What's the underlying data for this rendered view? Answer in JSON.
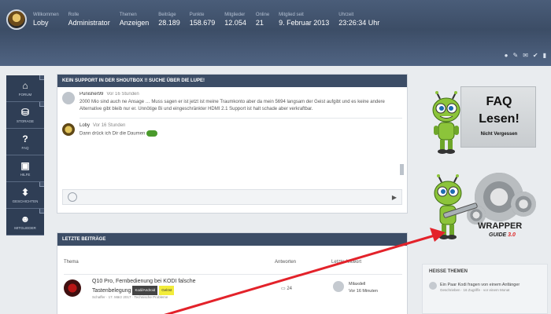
{
  "header": {
    "stats": [
      {
        "key": "Willkommen",
        "value": "Loby"
      },
      {
        "key": "Rolle",
        "value": "Administrator"
      },
      {
        "key": "Themen",
        "value": "Anzeigen"
      },
      {
        "key": "Beiträge",
        "value": "28.189"
      },
      {
        "key": "Punkte",
        "value": "158.679"
      },
      {
        "key": "Mitglieder",
        "value": "12.054"
      },
      {
        "key": "Online",
        "value": "21"
      },
      {
        "key": "Mitglied seit",
        "value": "9. Februar 2013"
      },
      {
        "key": "Uhrzeit",
        "value": "23:26:34 Uhr"
      }
    ],
    "icons": [
      "●",
      "✎",
      "✉",
      "✔",
      "▮"
    ]
  },
  "nav": [
    {
      "icon": "⌂",
      "label": "Forum"
    },
    {
      "icon": "⛁",
      "label": "Storage"
    },
    {
      "icon": "?",
      "label": "FAQ"
    },
    {
      "icon": "▣",
      "label": "Hilfe"
    },
    {
      "icon": "⬍",
      "label": "Geschichten"
    },
    {
      "icon": "☻",
      "label": "Mitglieder"
    }
  ],
  "shoutbox": {
    "title": "Kein Support in der Shoutbox !! Suche über die Lupe!",
    "messages": [
      {
        "user": "Punisher99",
        "time": "Vor 16 Stunden",
        "text": "2000 Mio sind auch ne Ansage … Muss sagen er ist jetzt ist meine Traumkonto aber da mein 5694 langsam der Geist aufgibt und es keine andere Alternative gibt bleib nur er. Unnötige Bi und eingeschränkter HDMI 2.1 Support ist halt schade aber verkraftbar."
      },
      {
        "user": "Loby",
        "time": "Vor 16 Stunden",
        "text": "Dann drück ich Dir die Daumen"
      }
    ],
    "input_placeholder": ""
  },
  "posts": {
    "title": "Letzte Beiträge",
    "col_topic": "Thema",
    "col_answers": "Antworten",
    "col_last": "Letzte Antwort",
    "rows": [
      {
        "title": "Q10 Pro, Fernbedienung bei KODI falsche Tastenbelegung",
        "badge1": "Kodi/Android",
        "badge2": "Gelöst",
        "meta": "Schaffer · 17. März 2017 · Technische Probleme",
        "answers": "24",
        "last_user": "Milaxdell",
        "last_time": "Vor 16 Minuten"
      }
    ]
  },
  "faq": {
    "line1": "FAQ",
    "line2": "Lesen!",
    "line3": "Nicht Vergessen"
  },
  "wrapper": {
    "line1": "WRAPPER",
    "line2a": "GUIDE",
    "line2b": "3.0"
  },
  "hot": {
    "title": "Heiße Themen",
    "items": [
      {
        "text": "Ein Paar Kodi fragen von einem Anfänger",
        "meta": "Geschrieben · 16 Zugriffe · vor einem Monat"
      }
    ]
  },
  "colors": {
    "header": "#3c4d66",
    "nav": "#2f3e55",
    "arrow": "#e3222a",
    "badge_yellow": "#f2ec3a"
  }
}
